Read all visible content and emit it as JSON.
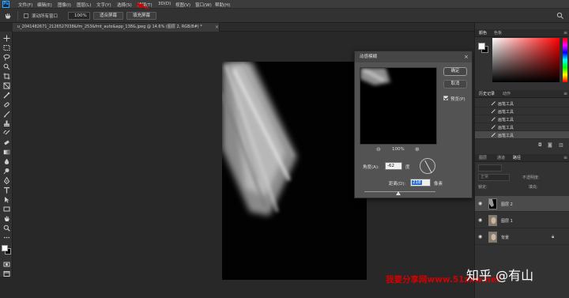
{
  "menu": {
    "items": [
      "文件(F)",
      "编辑(E)",
      "图像(I)",
      "图层(L)",
      "文字(Y)",
      "选择(S)",
      "滤镜(T)",
      "3D(D)",
      "视图(V)",
      "窗口(W)",
      "帮助(H)"
    ]
  },
  "options_bar": {
    "scroll_all_windows": "滚动所有窗口",
    "zoom": "100%",
    "fit_screen": "适合屏幕",
    "fill_screen": "填充屏幕"
  },
  "document": {
    "tab_title": "u_2041482671_2126527038&fm_253&fmt_auto&app_138&.jpeg @ 14.6% (图层 2, RGB/8#) *"
  },
  "dialog": {
    "title": "动感模糊",
    "ok": "确定",
    "cancel": "取消",
    "preview": "预览(P)",
    "zoom": "100%",
    "angle_label": "角度(A):",
    "angle_value": "-62",
    "angle_unit": "度",
    "angle_deg": -62,
    "distance_label": "距离(D):",
    "distance_value": "218",
    "distance_unit": "像素",
    "preview_checked": true
  },
  "panels": {
    "color_tabs": [
      "颜色",
      "色板"
    ],
    "history_tabs": [
      "历史记录",
      "动作"
    ],
    "history_items": [
      "画笔工具",
      "画笔工具",
      "画笔工具",
      "画笔工具",
      "画笔工具"
    ],
    "history_active": 4,
    "layers_tabs": [
      "图层",
      "通道",
      "路径"
    ],
    "blend_mode": "正常",
    "opacity": "不透明度:",
    "lock": "锁定:",
    "fill": "填充:",
    "layers": [
      {
        "name": "图层 2",
        "active": true,
        "locked": false
      },
      {
        "name": "图层 1",
        "active": false,
        "locked": false
      },
      {
        "name": "背景",
        "active": false,
        "locked": true
      }
    ]
  },
  "watermarks": {
    "left": "我要分享网www.51zxw.net",
    "right": "知乎 @有山"
  },
  "colors": {
    "accent_arrow": "#d40000",
    "watermark_red": "#d40000",
    "selection_blue": "#2d6fcf"
  }
}
